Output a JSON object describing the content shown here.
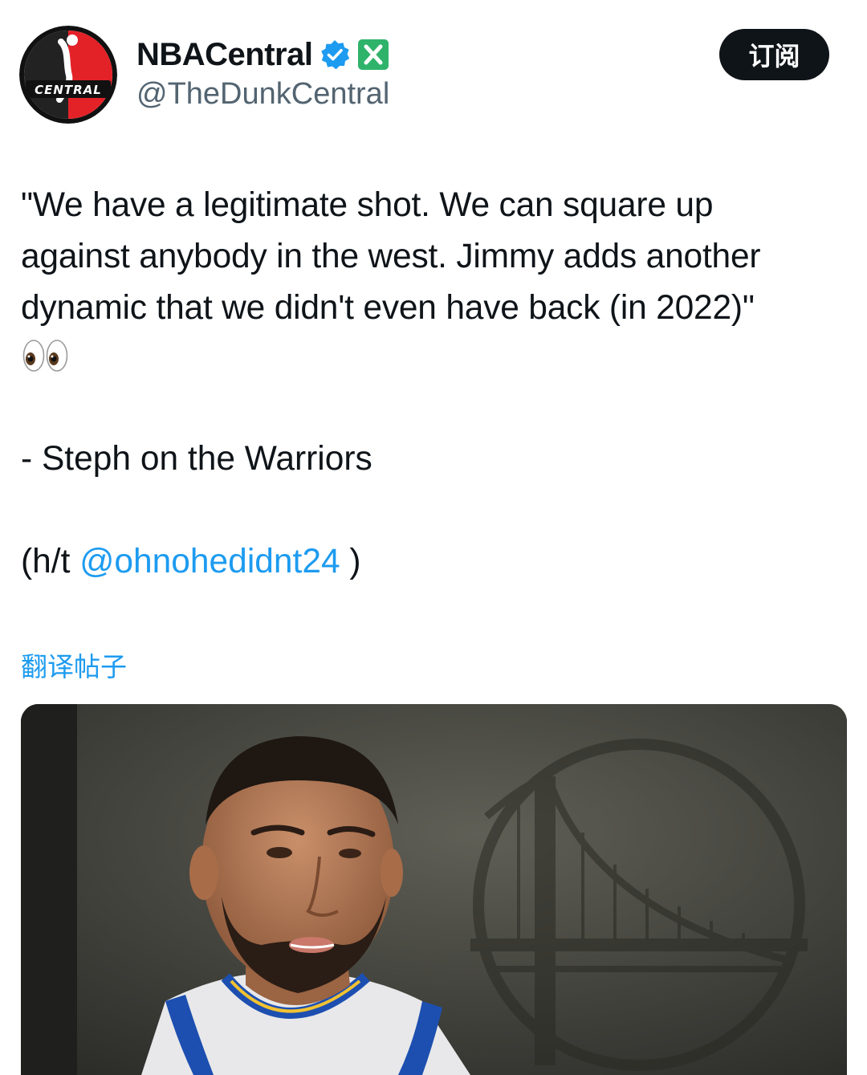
{
  "author": {
    "display_name": "NBACentral",
    "handle": "@TheDunkCentral",
    "avatar_text": "CENTRAL",
    "verified_icon": "verified-badge-icon",
    "affiliate_icon": "x-affiliate-icon"
  },
  "actions": {
    "subscribe_label": "订阅"
  },
  "tweet": {
    "lines": [
      "\"We have a legitimate shot. We can square up",
      "against anybody in the west. Jimmy adds another",
      "dynamic that we didn't even have back (in 2022)\""
    ],
    "emoji": "eyes-emoji",
    "signoff": "- Steph on the Warriors",
    "ht_prefix": "(h/t ",
    "mention": "@ohnohedidnt24",
    "ht_suffix": " )"
  },
  "translate_label": "翻译帖子",
  "colors": {
    "text": "#0f1419",
    "secondary": "#536471",
    "link": "#1d9bf0",
    "button_bg": "#0f1419",
    "verified": "#1d9bf0",
    "affiliate": "#2fb36b"
  }
}
